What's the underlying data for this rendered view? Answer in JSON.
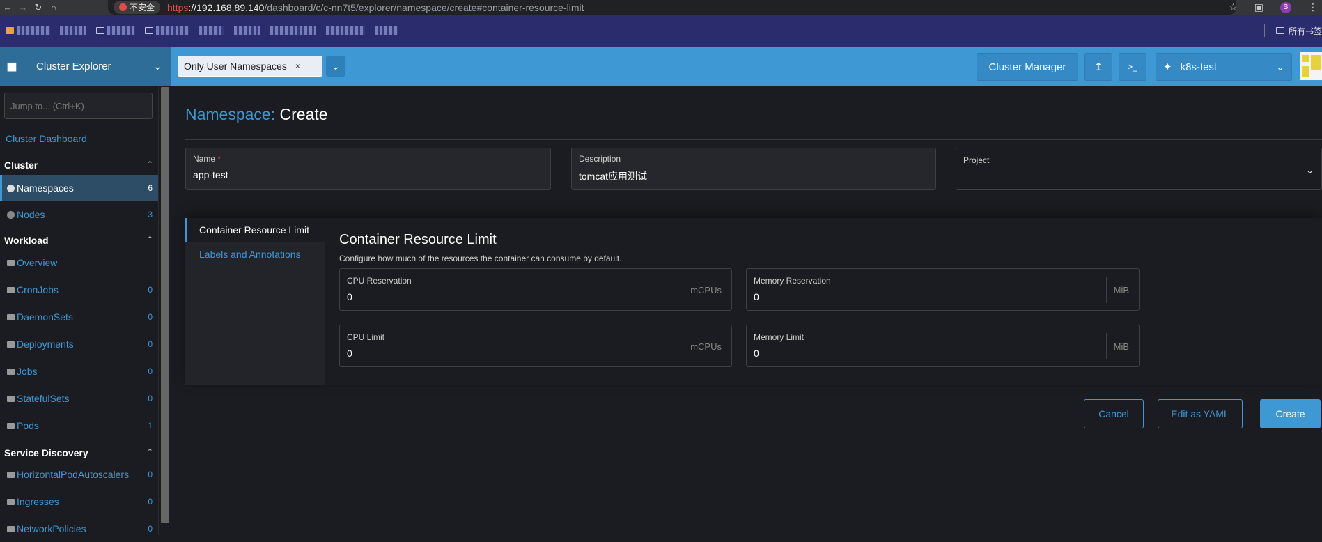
{
  "browser": {
    "security_label": "不安全",
    "url_scheme": "https",
    "url_host": "://192.168.89.140",
    "url_path": "/dashboard/c/c-nn7t5/explorer/namespace/create#container-resource-limit",
    "profile_initial": "S",
    "bookmarks": [
      "",
      "",
      "",
      "",
      "",
      "",
      "",
      "",
      ""
    ],
    "all_bookmarks_label": "所有书签"
  },
  "header": {
    "brand_title": "Cluster Explorer",
    "namespace_filter": "Only User Namespaces",
    "namespace_filter_remove": "×",
    "cluster_manager_label": "Cluster Manager",
    "cluster_name": "k8s-test"
  },
  "sidebar": {
    "jump_placeholder": "Jump to... (Ctrl+K)",
    "dashboard_link": "Cluster Dashboard",
    "groups": [
      {
        "label": "Cluster",
        "caret": "^"
      },
      {
        "label": "Workload",
        "caret": "^"
      },
      {
        "label": "Service Discovery",
        "caret": "^"
      }
    ],
    "items": [
      {
        "label": "Namespaces",
        "count": "6"
      },
      {
        "label": "Nodes",
        "count": "3"
      },
      {
        "label": "Overview",
        "count": ""
      },
      {
        "label": "CronJobs",
        "count": "0"
      },
      {
        "label": "DaemonSets",
        "count": "0"
      },
      {
        "label": "Deployments",
        "count": "0"
      },
      {
        "label": "Jobs",
        "count": "0"
      },
      {
        "label": "StatefulSets",
        "count": "0"
      },
      {
        "label": "Pods",
        "count": "1"
      },
      {
        "label": "HorizontalPodAutoscalers",
        "count": "0"
      },
      {
        "label": "Ingresses",
        "count": "0"
      },
      {
        "label": "NetworkPolicies",
        "count": "0"
      }
    ]
  },
  "page": {
    "title_prefix": "Namespace:",
    "title_action": "Create",
    "name_label": "Name",
    "name_required": "*",
    "name_value": "app-test",
    "description_label": "Description",
    "description_value": "tomcat应用测试",
    "project_label": "Project",
    "project_value": ""
  },
  "tabs": [
    {
      "label": "Container Resource Limit",
      "active": true
    },
    {
      "label": "Labels and Annotations",
      "active": false
    }
  ],
  "resource_limit": {
    "title": "Container Resource Limit",
    "description": "Configure how much of the resources the container can consume by default.",
    "fields": [
      {
        "label": "CPU Reservation",
        "value": "0",
        "unit": "mCPUs"
      },
      {
        "label": "Memory Reservation",
        "value": "0",
        "unit": "MiB"
      },
      {
        "label": "CPU Limit",
        "value": "0",
        "unit": "mCPUs"
      },
      {
        "label": "Memory Limit",
        "value": "0",
        "unit": "MiB"
      }
    ]
  },
  "footer": {
    "cancel_label": "Cancel",
    "yaml_label": "Edit as YAML",
    "create_label": "Create"
  },
  "colors": {
    "accent": "#3d98d3",
    "header_bg": "#3d98d3",
    "brand_bg": "#2d6d98",
    "page_bg": "#1b1c21",
    "required": "#e24a4a"
  }
}
